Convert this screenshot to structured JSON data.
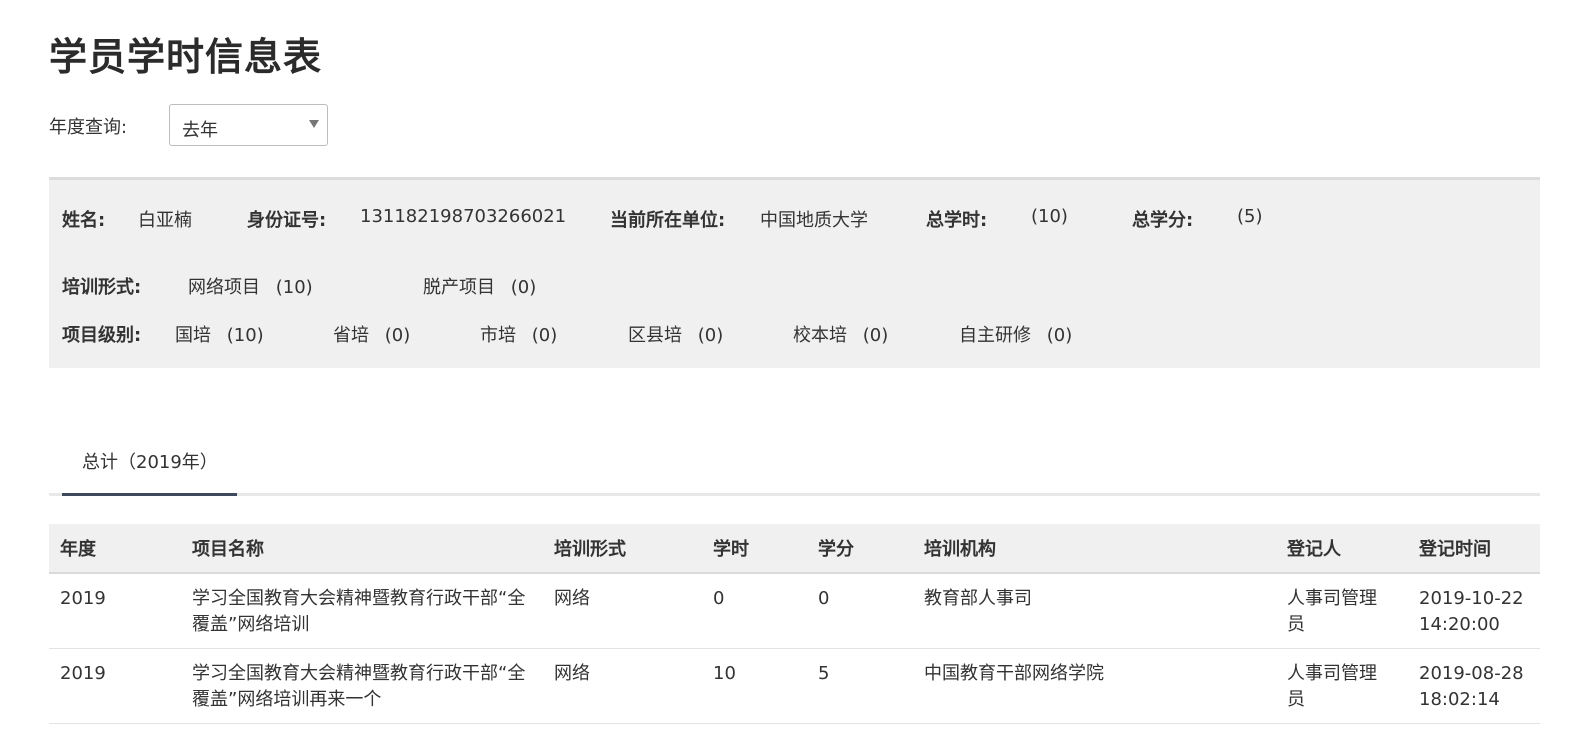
{
  "page_title": "学员学时信息表",
  "year_filter": {
    "label": "年度查询:",
    "selected": "去年"
  },
  "student": {
    "name_label": "姓名:",
    "name": "白亚楠",
    "id_label": "身份证号:",
    "id_number": "131182198703266021",
    "unit_label": "当前所在单位:",
    "unit": "中国地质大学",
    "total_hours_label": "总学时:",
    "total_hours": "(10)",
    "total_credits_label": "总学分:",
    "total_credits": "(5)"
  },
  "training_form": {
    "label": "培训形式:",
    "items": [
      {
        "name": "网络项目",
        "count": "(10)"
      },
      {
        "name": "脱产项目",
        "count": "(0)"
      }
    ]
  },
  "project_level": {
    "label": "项目级别:",
    "items": [
      {
        "name": "国培",
        "count": "(10)"
      },
      {
        "name": "省培",
        "count": "(0)"
      },
      {
        "name": "市培",
        "count": "(0)"
      },
      {
        "name": "区县培",
        "count": "(0)"
      },
      {
        "name": "校本培",
        "count": "(0)"
      },
      {
        "name": "自主研修",
        "count": "(0)"
      }
    ]
  },
  "tabs": [
    {
      "label": "总计（2019年）",
      "active": true
    }
  ],
  "table": {
    "headers": [
      "年度",
      "项目名称",
      "培训形式",
      "学时",
      "学分",
      "培训机构",
      "登记人",
      "登记时间"
    ],
    "rows": [
      [
        "2019",
        "学习全国教育大会精神暨教育行政干部“全覆盖”网络培训",
        "网络",
        "0",
        "0",
        "教育部人事司",
        "人事司管理员",
        "2019-10-22 14:20:00"
      ],
      [
        "2019",
        "学习全国教育大会精神暨教育行政干部“全覆盖”网络培训再来一个",
        "网络",
        "10",
        "5",
        "中国教育干部网络学院",
        "人事司管理员",
        "2019-08-28 18:02:14"
      ]
    ]
  }
}
